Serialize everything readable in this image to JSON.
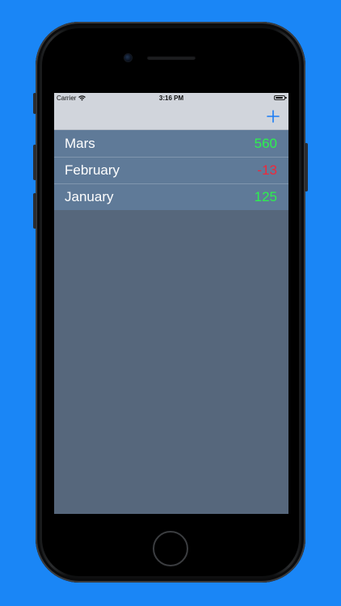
{
  "status_bar": {
    "carrier": "Carrier",
    "time": "3:16 PM"
  },
  "nav_bar": {
    "add_icon": "plus-icon",
    "accent_color": "#1a7cf5"
  },
  "entries": [
    {
      "label": "Mars",
      "value": "560",
      "sign": "positive"
    },
    {
      "label": "February",
      "value": "-13",
      "sign": "negative"
    },
    {
      "label": "January",
      "value": "125",
      "sign": "positive"
    }
  ],
  "colors": {
    "background": "#1a86f6",
    "screen": "#56677c",
    "row": "#5f7a98",
    "positive": "#2cf24d",
    "negative": "#f0283a"
  }
}
